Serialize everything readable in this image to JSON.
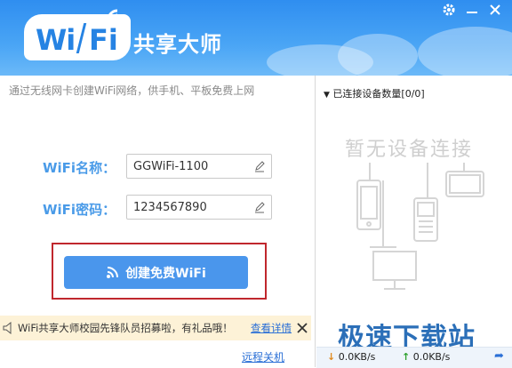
{
  "header": {
    "logo_wi": "Wi",
    "logo_fi": "Fi",
    "logo_title": "共享大师"
  },
  "window_buttons": [
    {
      "icon": "gear-icon"
    },
    {
      "icon": "minimize-icon"
    },
    {
      "icon": "close-icon"
    }
  ],
  "left": {
    "subtitle": "通过无线网卡创建WiFi网络，供手机、平板免费上网",
    "name_label": "WiFi名称：",
    "name_value": "GGWiFi-1100",
    "password_label": "WiFi密码：",
    "password_value": "1234567890",
    "create_button": "创建免费WiFi"
  },
  "notice": {
    "text": "WiFi共享大师校园先锋队员招募啦，有礼品哦！",
    "link": "查看详情"
  },
  "remote_shutdown": "远程关机",
  "right": {
    "device_header": "已连接设备数量[0/0]",
    "no_device": "暂无设备连接"
  },
  "status": {
    "download": "0.0KB/s",
    "upload": "0.0KB/s"
  },
  "watermark": "极速下载站",
  "colors": {
    "accent": "#4a96ec",
    "header": "#2f8ef0",
    "highlight_border": "#c0272d",
    "notice_bg": "#fdf2d7",
    "link": "#2a6fd6"
  }
}
